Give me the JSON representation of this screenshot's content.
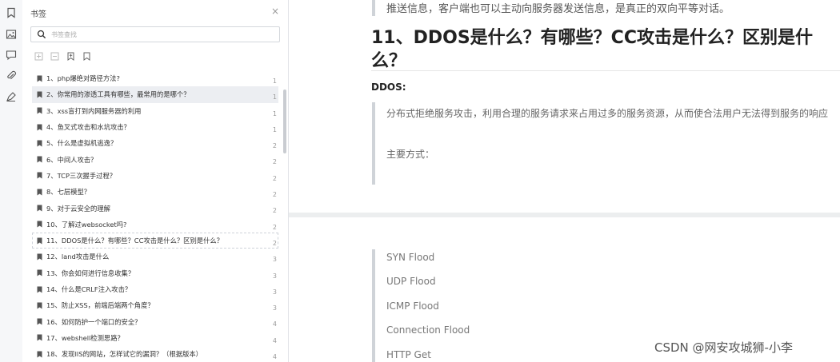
{
  "sidebar_rail": {
    "icons": [
      "bookmark-icon",
      "image-icon",
      "comment-icon",
      "attachment-icon",
      "signature-icon"
    ]
  },
  "bookmarks_panel": {
    "title": "书签",
    "close_label": "×",
    "search_placeholder": "书签查找",
    "items": [
      {
        "label": "1、php爆绝对路径方法?",
        "page": "1"
      },
      {
        "label": "2、你常用的渗透工具有哪些，最常用的是哪个？",
        "page": "1"
      },
      {
        "label": "3、xss盲打到内网服务器的利用",
        "page": "1"
      },
      {
        "label": "4、鱼叉式攻击和水坑攻击？",
        "page": "1"
      },
      {
        "label": "5、什么是虚拟机逃逸？",
        "page": "2"
      },
      {
        "label": "6、中间人攻击？",
        "page": "2"
      },
      {
        "label": "7、TCP三次握手过程？",
        "page": "2"
      },
      {
        "label": "8、七层模型？",
        "page": "2"
      },
      {
        "label": "9、对于云安全的理解",
        "page": "2"
      },
      {
        "label": "10、了解过websocket吗?",
        "page": "2"
      },
      {
        "label": "11、DDOS是什么？有哪些？CC攻击是什么？区别是什么？",
        "page": "2"
      },
      {
        "label": "12、land攻击是什么",
        "page": "3"
      },
      {
        "label": "13、你会如何进行信息收集？",
        "page": "3"
      },
      {
        "label": "14、什么是CRLF注入攻击？",
        "page": "3"
      },
      {
        "label": "15、防止XSS，前端后端两个角度？",
        "page": "3"
      },
      {
        "label": "16、如何防护一个端口的安全？",
        "page": "4"
      },
      {
        "label": "17、webshell检测思路？",
        "page": "4"
      },
      {
        "label": "18、发现IIS的网站，怎样试它的漏洞？（根据版本）",
        "page": "4"
      }
    ]
  },
  "document": {
    "top_text": "推送信息，客户端也可以主动向服务器发送信息，是真正的双向平等对话。",
    "heading": "11、DDOS是什么？有哪些？CC攻击是什么？区别是什么？",
    "subheading": "DDOS:",
    "paragraph": "分布式拒绝服务攻击，利用合理的服务请求来占用过多的服务资源，从而使合法用户无法得到服务的响应",
    "main_methods": "主要方式：",
    "methods": [
      "SYN Flood",
      "UDP Flood",
      "ICMP Flood",
      "Connection Flood",
      "HTTP Get"
    ]
  },
  "watermark": "CSDN @网安攻城狮-小李"
}
